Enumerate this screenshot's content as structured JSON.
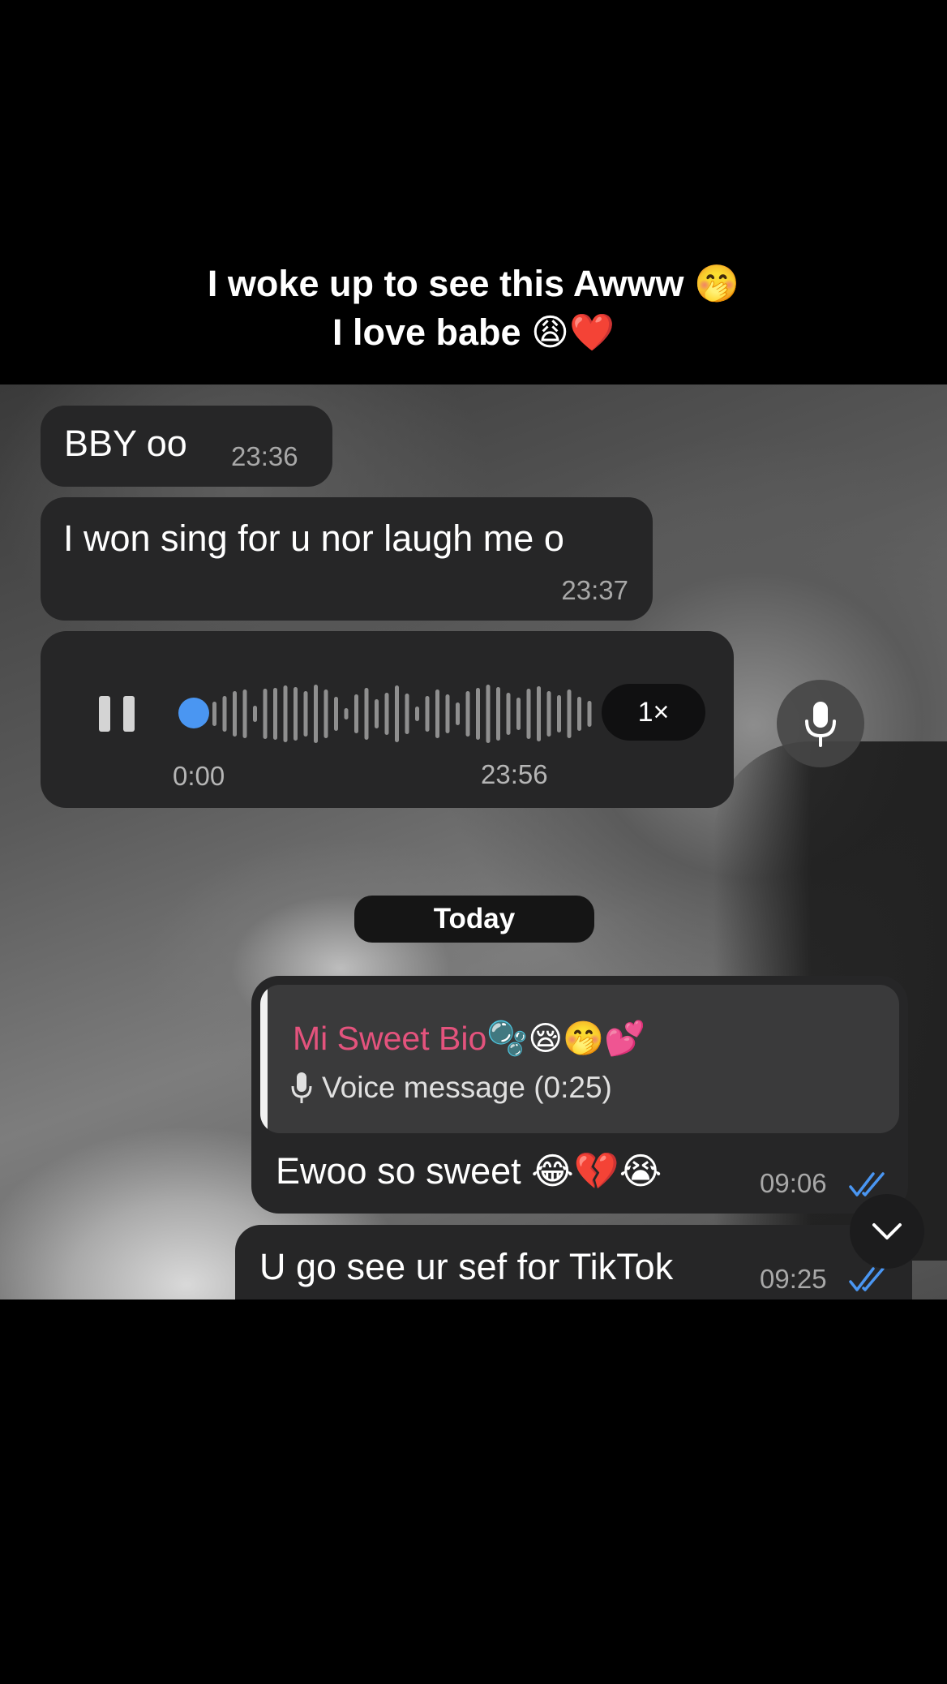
{
  "caption": {
    "line1": "I woke up to see this Awww 🤭",
    "line2": "I love babe 😩❤️"
  },
  "messages": [
    {
      "text": "BBY oo",
      "time": "23:36",
      "direction": "incoming"
    },
    {
      "text": "I won sing for u nor laugh me o",
      "time": "23:37",
      "direction": "incoming"
    }
  ],
  "voice_message": {
    "elapsed": "0:00",
    "time": "23:56",
    "speed": "1×",
    "state": "playing",
    "progress": 0
  },
  "day_separator": "Today",
  "reply_message": {
    "quoted_name": "Mi Sweet Bio",
    "quoted_emojis": "🫧😪🤭💕",
    "quoted_preview": "Voice message (0:25)",
    "text": "Ewoo so sweet 😂💔😭",
    "time": "09:06",
    "status": "read"
  },
  "last_message": {
    "text": "U go see ur sef for TikTok",
    "time": "09:25",
    "status": "read"
  },
  "icons": {
    "pause": "pause-icon",
    "mic": "microphone-icon",
    "down": "chevron-down-icon",
    "read": "double-check-icon"
  },
  "colors": {
    "bubble": "#262627",
    "accent_blue": "#4a96f2",
    "reply_name": "#e4537d"
  }
}
